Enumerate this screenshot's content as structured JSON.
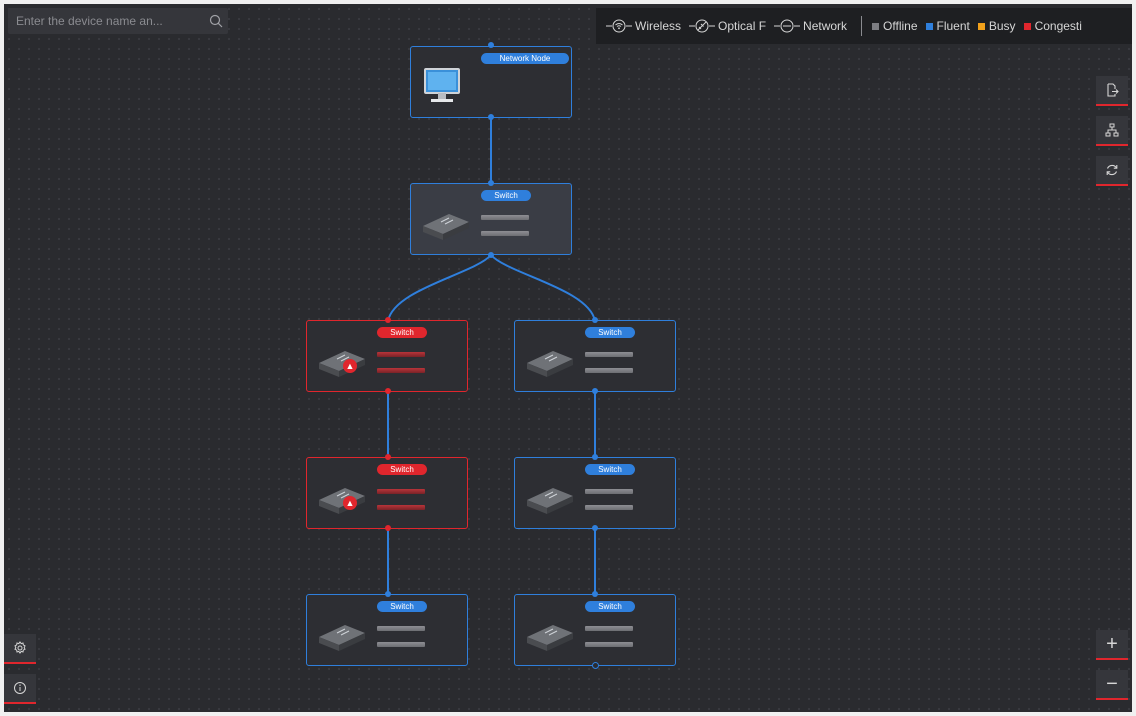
{
  "search": {
    "placeholder": "Enter the device name an..."
  },
  "legend": {
    "links": [
      {
        "label": "Wireless",
        "icon": "wifi-link-icon"
      },
      {
        "label": "Optical F",
        "icon": "optical-fiber-link-icon"
      },
      {
        "label": "Network",
        "icon": "network-cable-link-icon"
      }
    ],
    "statuses": [
      {
        "label": "Offline",
        "color": "#7d7e83"
      },
      {
        "label": "Fluent",
        "color": "#2f7fdc"
      },
      {
        "label": "Busy",
        "color": "#f2a11b"
      },
      {
        "label": "Congesti",
        "color": "#e0262d"
      }
    ]
  },
  "toolbar_right": [
    "export-icon",
    "topology-layout-icon",
    "refresh-icon"
  ],
  "zoom": {
    "in": "+",
    "out": "−"
  },
  "nodes": {
    "root": {
      "label": "Network Node",
      "type": "network-node"
    },
    "switch_level1": {
      "label": "Switch",
      "status": "fluent"
    },
    "switch_left_1": {
      "label": "Switch",
      "status": "congestion"
    },
    "switch_right_1": {
      "label": "Switch",
      "status": "fluent"
    },
    "switch_left_2": {
      "label": "Switch",
      "status": "congestion"
    },
    "switch_right_2": {
      "label": "Switch",
      "status": "fluent"
    },
    "switch_left_3": {
      "label": "Switch",
      "status": "fluent"
    },
    "switch_right_3": {
      "label": "Switch",
      "status": "fluent"
    }
  },
  "colors": {
    "fluent": "#2f7fdc",
    "congestion": "#e0262d",
    "canvas": "#2a2b2f"
  }
}
